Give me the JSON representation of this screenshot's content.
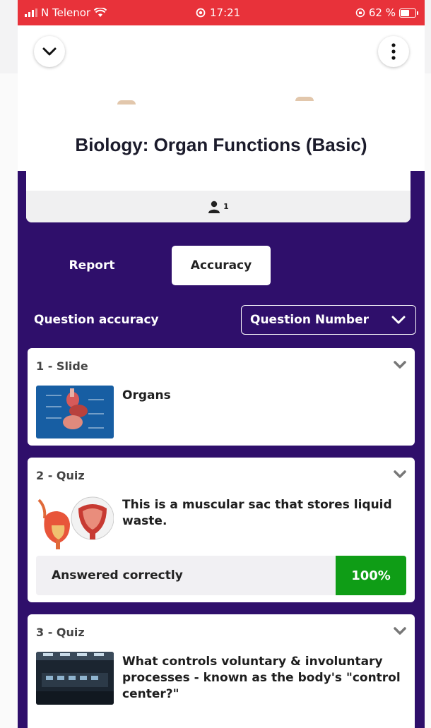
{
  "status_bar": {
    "carrier": "N Telenor",
    "time": "17:21",
    "battery": "62 %"
  },
  "header": {
    "title": "Biology: Organ Functions (Basic)",
    "players_count": "1"
  },
  "tabs": [
    {
      "label": "Report",
      "active": false
    },
    {
      "label": "Accuracy",
      "active": true
    }
  ],
  "section": {
    "label": "Question accuracy",
    "sort_label": "Question Number"
  },
  "questions": [
    {
      "number_type": "1 - Slide",
      "text": "Organs"
    },
    {
      "number_type": "2 - Quiz",
      "text": "This is a muscular sac that stores liquid waste.",
      "answer_label": "Answered correctly",
      "percent": "100%",
      "percent_color": "#0f9d16"
    },
    {
      "number_type": "3 - Quiz",
      "text": "What controls voluntary & involuntary processes - known as the body's \"control center?\""
    }
  ]
}
